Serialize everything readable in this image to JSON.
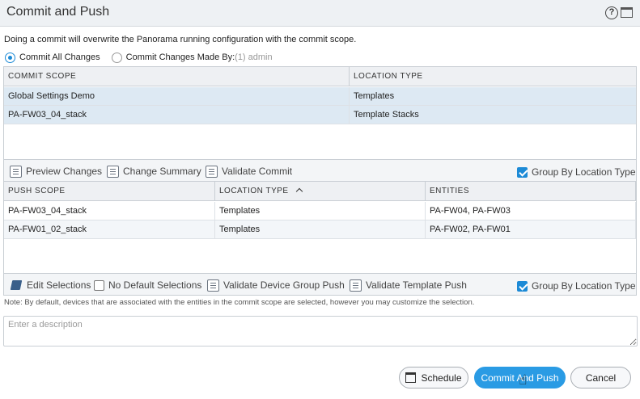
{
  "window": {
    "title": "Commit and Push"
  },
  "intro_text": "Doing a commit will overwrite the Panorama running configuration with the commit scope.",
  "commit_options": {
    "all_label": "Commit All Changes",
    "made_by_label": "Commit Changes Made By:",
    "made_by_value": "(1) admin"
  },
  "commit_grid": {
    "headers": [
      "COMMIT SCOPE",
      "LOCATION TYPE"
    ],
    "rows": [
      [
        "Global Settings Demo",
        "Templates"
      ],
      [
        "PA-FW03_04_stack",
        "Template Stacks"
      ]
    ]
  },
  "commit_toolbar": {
    "preview": "Preview Changes",
    "summary": "Change Summary",
    "validate": "Validate Commit",
    "group_by": "Group By Location Type"
  },
  "push_grid": {
    "headers": [
      "PUSH SCOPE",
      "LOCATION TYPE",
      "ENTITIES"
    ],
    "sort_indicator": "^",
    "rows": [
      [
        "PA-FW03_04_stack",
        "Templates",
        "PA-FW04, PA-FW03"
      ],
      [
        "PA-FW01_02_stack",
        "Templates",
        "PA-FW02, PA-FW01"
      ]
    ]
  },
  "push_toolbar": {
    "edit": "Edit Selections",
    "no_default": "No Default Selections",
    "validate_dg": "Validate Device Group Push",
    "validate_tpl": "Validate Template Push",
    "group_by": "Group By Location Type"
  },
  "note": "Note: By default, devices that are associated with the entities in the commit scope are selected, however you may customize the selection.",
  "description": {
    "placeholder": "Enter a description",
    "value": ""
  },
  "buttons": {
    "schedule": "Schedule",
    "commit_push": "Commit And Push",
    "cancel": "Cancel"
  },
  "colors": {
    "accent": "#2a9be4",
    "selected_row": "#dde9f3",
    "header_bg": "#eef0f3"
  }
}
